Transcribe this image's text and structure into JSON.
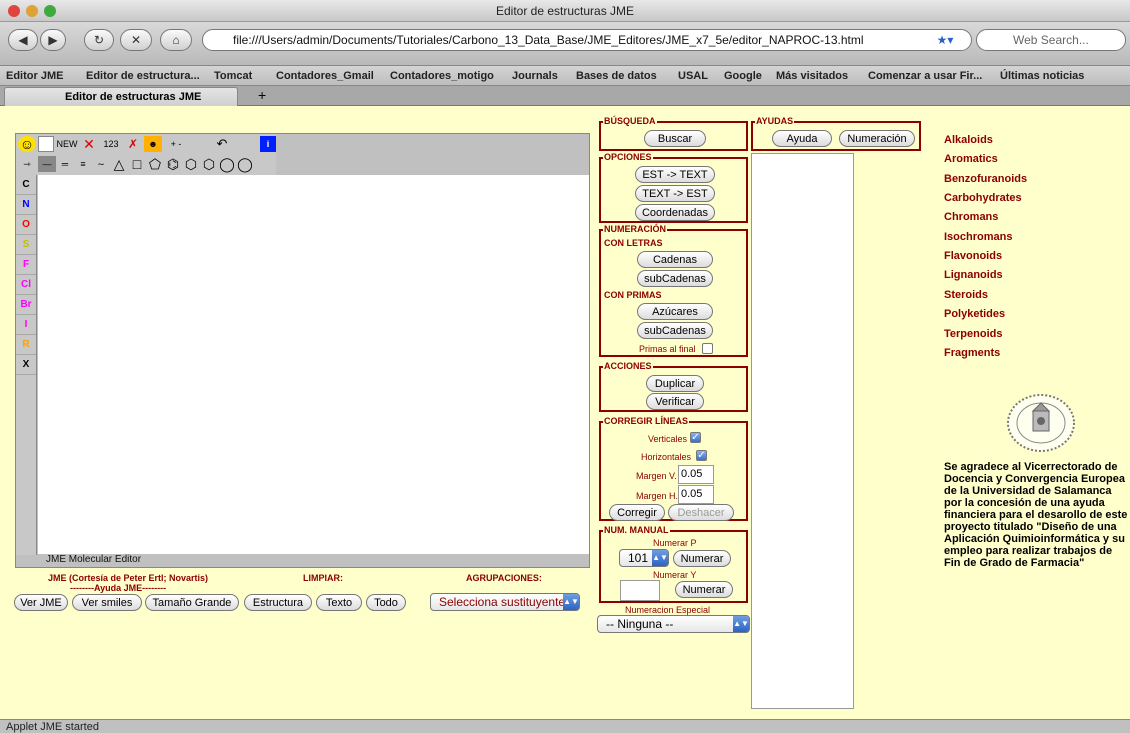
{
  "window": {
    "title": "Editor de estructuras JME"
  },
  "nav": {
    "url": "file:///Users/admin/Documents/Tutoriales/Carbono_13_Data_Base/JME_Editores/JME_x7_5e/editor_NAPROC-13.html",
    "search_placeholder": "Web Search..."
  },
  "bookmarks": [
    "Editor JME",
    "Editor de estructura...",
    "Tomcat",
    "Contadores_Gmail",
    "Contadores_motigo",
    "Journals",
    "Bases de datos",
    "USAL",
    "Google",
    "Más visitados",
    "Comenzar a usar Fir...",
    "Últimas noticias"
  ],
  "tab": {
    "label": "Editor de estructuras JME",
    "new_tab": "+"
  },
  "jme": {
    "toolbar_new": "NEW",
    "toolbar_123": "123",
    "toolbar_charge": "+ -",
    "elements": [
      "C",
      "N",
      "O",
      "S",
      "F",
      "Cl",
      "Br",
      "I",
      "R",
      "X"
    ],
    "status": "JME Molecular Editor"
  },
  "below_applet": {
    "credit": "JME (Cortesía de Peter Ertl; Novartis)",
    "limpiar": "LIMPIAR:",
    "agrupaciones": "AGRUPACIONES:",
    "ayuda_jme": "--------Ayuda JME--------",
    "buttons": [
      "Ver JME",
      "Ver smiles",
      "Tamaño Grande",
      "Estructura",
      "Texto",
      "Todo"
    ],
    "select_sustituyente": "Selecciona sustituyente"
  },
  "busqueda": {
    "legend": "BÚSQUEDA",
    "buscar": "Buscar"
  },
  "opciones": {
    "legend": "OPCIONES",
    "buttons": [
      "EST -> TEXT",
      "TEXT -> EST",
      "Coordenadas"
    ]
  },
  "numeracion": {
    "legend": "NUMERACIÓN",
    "con_letras": "CON LETRAS",
    "cadenas": "Cadenas",
    "subcadenas": "subCadenas",
    "con_primas": "CON PRIMAS",
    "azucares": "Azúcares",
    "subcadenas2": "subCadenas",
    "primas_final": "Primas al final"
  },
  "acciones": {
    "legend": "ACCIONES",
    "duplicar": "Duplicar",
    "verificar": "Verificar"
  },
  "corregir": {
    "legend": "CORREGIR LÍNEAS",
    "verticales": "Verticales",
    "horizontales": "Horizontales",
    "margen_v_label": "Margen V.",
    "margen_v": "0.05",
    "margen_h_label": "Margen H.",
    "margen_h": "0.05",
    "corregir": "Corregir",
    "deshacer": "Deshacer"
  },
  "num_manual": {
    "legend": "NUM. MANUAL",
    "numerar_p": "Numerar P",
    "p_value": "101",
    "numerar": "Numerar",
    "numerar_y": "Numerar Y",
    "numerar2": "Numerar",
    "especial_label": "Numeracion Especial",
    "especial_value": "-- Ninguna --"
  },
  "ayudas": {
    "legend": "AYUDAS",
    "ayuda": "Ayuda",
    "numeracion": "Numeración"
  },
  "categories": [
    "Alkaloids",
    "Aromatics",
    "Benzofuranoids",
    "Carbohydrates",
    "Chromans",
    "Isochromans",
    "Flavonoids",
    "Lignanoids",
    "Steroids",
    "Polyketides",
    "Terpenoids",
    "Fragments"
  ],
  "thanks": "Se agradece al Vicerrectorado de Docencia y Convergencia Europea de la Universidad de Salamanca por la concesión de una ayuda financiera para el desarollo de este proyecto titulado \"Diseño de una Aplicación Quimioinformática y su empleo para realizar trabajos de Fin de Grado de Farmacia\"",
  "statusbar": "Applet JME started"
}
